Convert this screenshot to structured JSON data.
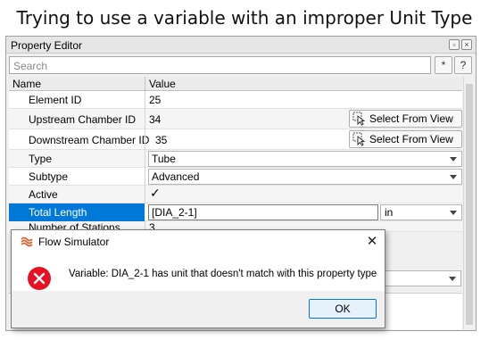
{
  "caption": "Trying to use a variable with an improper Unit Type",
  "property_editor": {
    "title": "Property Editor",
    "title_buttons": [
      "restore-icon",
      "close-icon"
    ],
    "search_placeholder": "Search",
    "search_buttons": {
      "clear": "*",
      "help": "?"
    },
    "columns": {
      "name": "Name",
      "value": "Value"
    },
    "rows": {
      "element_id": {
        "name": "Element ID",
        "value": "25"
      },
      "upstream": {
        "name": "Upstream Chamber ID",
        "value": "34",
        "button": "Select From View"
      },
      "downstream": {
        "name": "Downstream Chamber ID",
        "value": "35",
        "button": "Select From View"
      },
      "type": {
        "name": "Type",
        "value": "Tube"
      },
      "subtype": {
        "name": "Subtype",
        "value": "Advanced"
      },
      "active": {
        "name": "Active",
        "value": "✓"
      },
      "total_length": {
        "name": "Total Length",
        "value": "[DIA_2-1]",
        "unit": "in"
      },
      "stations": {
        "name": "Number of Stations",
        "value": "3"
      }
    },
    "colors": {
      "selection": "#0078d7"
    }
  },
  "dialog": {
    "title": "Flow Simulator",
    "message": "Variable: DIA_2-1 has unit that doesn't match with this property type",
    "ok_label": "OK",
    "icon": "error-icon",
    "colors": {
      "error": "#e81123"
    }
  }
}
